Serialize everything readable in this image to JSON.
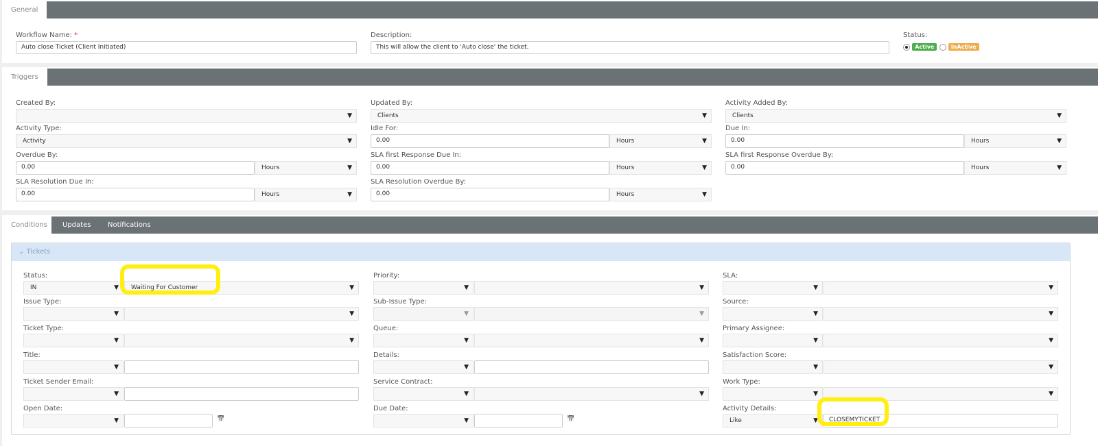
{
  "general": {
    "tab": "General",
    "name_label": "Workflow Name:",
    "required_mark": "*",
    "name_value": "Auto close Ticket (Client Initiated)",
    "desc_label": "Description:",
    "desc_value": "This will allow the client to 'Auto close' the ticket.",
    "status_label": "Status:",
    "active_label": "Active",
    "inactive_label": "InActive",
    "selected_status": "Active",
    "active_color": "#4cae4c",
    "inactive_color": "#f0ad4e"
  },
  "triggers": {
    "tab": "Triggers",
    "fields": [
      {
        "label": "Created By:",
        "type": "select",
        "value": ""
      },
      {
        "label": "Updated By:",
        "type": "select",
        "value": "Clients"
      },
      {
        "label": "Activity Added By:",
        "type": "select",
        "value": "Clients"
      },
      {
        "label": "Activity Type:",
        "type": "select",
        "value": "Activity"
      },
      {
        "label": "Idle For:",
        "type": "number",
        "value": "0.00",
        "unit": "Hours"
      },
      {
        "label": "Due In:",
        "type": "number",
        "value": "0.00",
        "unit": "Hours"
      },
      {
        "label": "Overdue By:",
        "type": "number",
        "value": "0.00",
        "unit": "Hours"
      },
      {
        "label": "SLA first Response Due In:",
        "type": "number",
        "value": "0.00",
        "unit": "Hours"
      },
      {
        "label": "SLA first Response Overdue By:",
        "type": "number",
        "value": "0.00",
        "unit": "Hours"
      },
      {
        "label": "SLA Resolution Due In:",
        "type": "number",
        "value": "0.00",
        "unit": "Hours"
      },
      {
        "label": "SLA Resolution Overdue By:",
        "type": "number",
        "value": "0.00",
        "unit": "Hours"
      }
    ]
  },
  "conditions": {
    "tabs": [
      "Conditions",
      "Updates",
      "Notifications"
    ],
    "section_title": "Tickets",
    "fields": [
      {
        "label": "Status:",
        "op": "IN",
        "type": "select",
        "value": "Waiting For Customer",
        "highlight": true
      },
      {
        "label": "Priority:",
        "op": "",
        "type": "select",
        "value": ""
      },
      {
        "label": "SLA:",
        "op": "",
        "type": "select",
        "value": ""
      },
      {
        "label": "Issue Type:",
        "op": "",
        "type": "select",
        "value": ""
      },
      {
        "label": "Sub-Issue Type:",
        "op": "",
        "type": "select",
        "value": "",
        "disabled": true
      },
      {
        "label": "Source:",
        "op": "",
        "type": "select",
        "value": ""
      },
      {
        "label": "Ticket Type:",
        "op": "",
        "type": "select",
        "value": ""
      },
      {
        "label": "Queue:",
        "op": "",
        "type": "select",
        "value": ""
      },
      {
        "label": "Primary Assignee:",
        "op": "",
        "type": "select",
        "value": ""
      },
      {
        "label": "Title:",
        "op": "",
        "type": "text",
        "value": ""
      },
      {
        "label": "Details:",
        "op": "",
        "type": "text",
        "value": ""
      },
      {
        "label": "Satisfaction Score:",
        "op": "",
        "type": "select",
        "value": ""
      },
      {
        "label": "Ticket Sender Email:",
        "op": "",
        "type": "text",
        "value": ""
      },
      {
        "label": "Service Contract:",
        "op": "",
        "type": "select",
        "value": ""
      },
      {
        "label": "Work Type:",
        "op": "",
        "type": "select",
        "value": ""
      },
      {
        "label": "Open Date:",
        "op": "",
        "type": "date",
        "value": ""
      },
      {
        "label": "Due Date:",
        "op": "",
        "type": "date",
        "value": ""
      },
      {
        "label": "Activity Details:",
        "op": "Like",
        "type": "text",
        "value": "CLOSEMYTICKET",
        "highlight": true
      }
    ]
  }
}
